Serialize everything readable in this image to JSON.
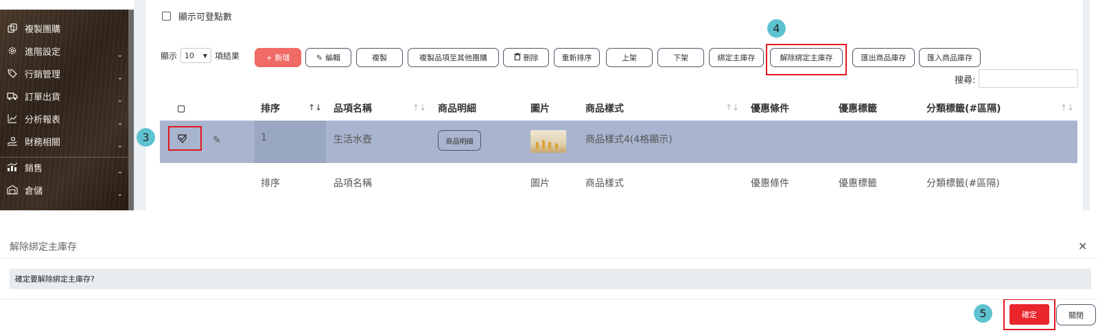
{
  "sidebar": {
    "items": [
      {
        "label": "複製團購",
        "icon": "copy-icon",
        "has_chevron": false
      },
      {
        "label": "進階設定",
        "icon": "gear-icon",
        "has_chevron": true
      },
      {
        "label": "行銷管理",
        "icon": "tag-icon",
        "has_chevron": true
      },
      {
        "label": "訂單出貨",
        "icon": "truck-icon",
        "has_chevron": true
      },
      {
        "label": "分析報表",
        "icon": "line-chart-icon",
        "has_chevron": true
      },
      {
        "label": "財務相關",
        "icon": "hand-coin-icon",
        "has_chevron": true
      },
      {
        "label": "銷售",
        "icon": "bar-chart-icon",
        "has_chevron": true
      },
      {
        "label": "倉儲",
        "icon": "warehouse-icon",
        "has_chevron": true
      }
    ]
  },
  "toolbar": {
    "show_points_label": "顯示可登點數",
    "show_label": "顯示",
    "page_size": "10",
    "results_label": "項結果",
    "buttons": {
      "add": "+ 新增",
      "edit": "編輯",
      "copy": "複製",
      "copy_to_other": "複製品項至其他團購",
      "delete": "刪除",
      "reorder": "重新排序",
      "publish": "上架",
      "unpublish": "下架",
      "bind_main": "綁定主庫存",
      "unbind_main": "解除綁定主庫存",
      "export_stock": "匯出商品庫存",
      "import_stock": "匯入商品庫存"
    },
    "search_label": "搜尋:",
    "search_value": ""
  },
  "table": {
    "headers": {
      "order": "排序",
      "name": "品項名稱",
      "detail": "商品明細",
      "image": "圖片",
      "style": "商品樣式",
      "promo": "優惠條件",
      "promo_tag": "優惠標籤",
      "category": "分類標籤(#區隔)"
    },
    "row": {
      "order": "1",
      "name": "生活水壺",
      "detail_button": "商品明細",
      "style": "商品樣式4(4格顯示)"
    },
    "footer": {
      "order": "排序",
      "name": "品項名稱",
      "image": "圖片",
      "style": "商品樣式",
      "promo": "優惠條件",
      "promo_tag": "優惠標籤",
      "category": "分類標籤(#區隔)"
    }
  },
  "annotations": {
    "step3": "3",
    "step4": "4",
    "step5": "5",
    "highlight_color": "#e3151b",
    "badge_color": "#5fc2d0"
  },
  "modal": {
    "title": "解除綁定主庫存",
    "message": "確定要解除綁定主庫存?",
    "confirm": "確定",
    "close": "關閉"
  }
}
